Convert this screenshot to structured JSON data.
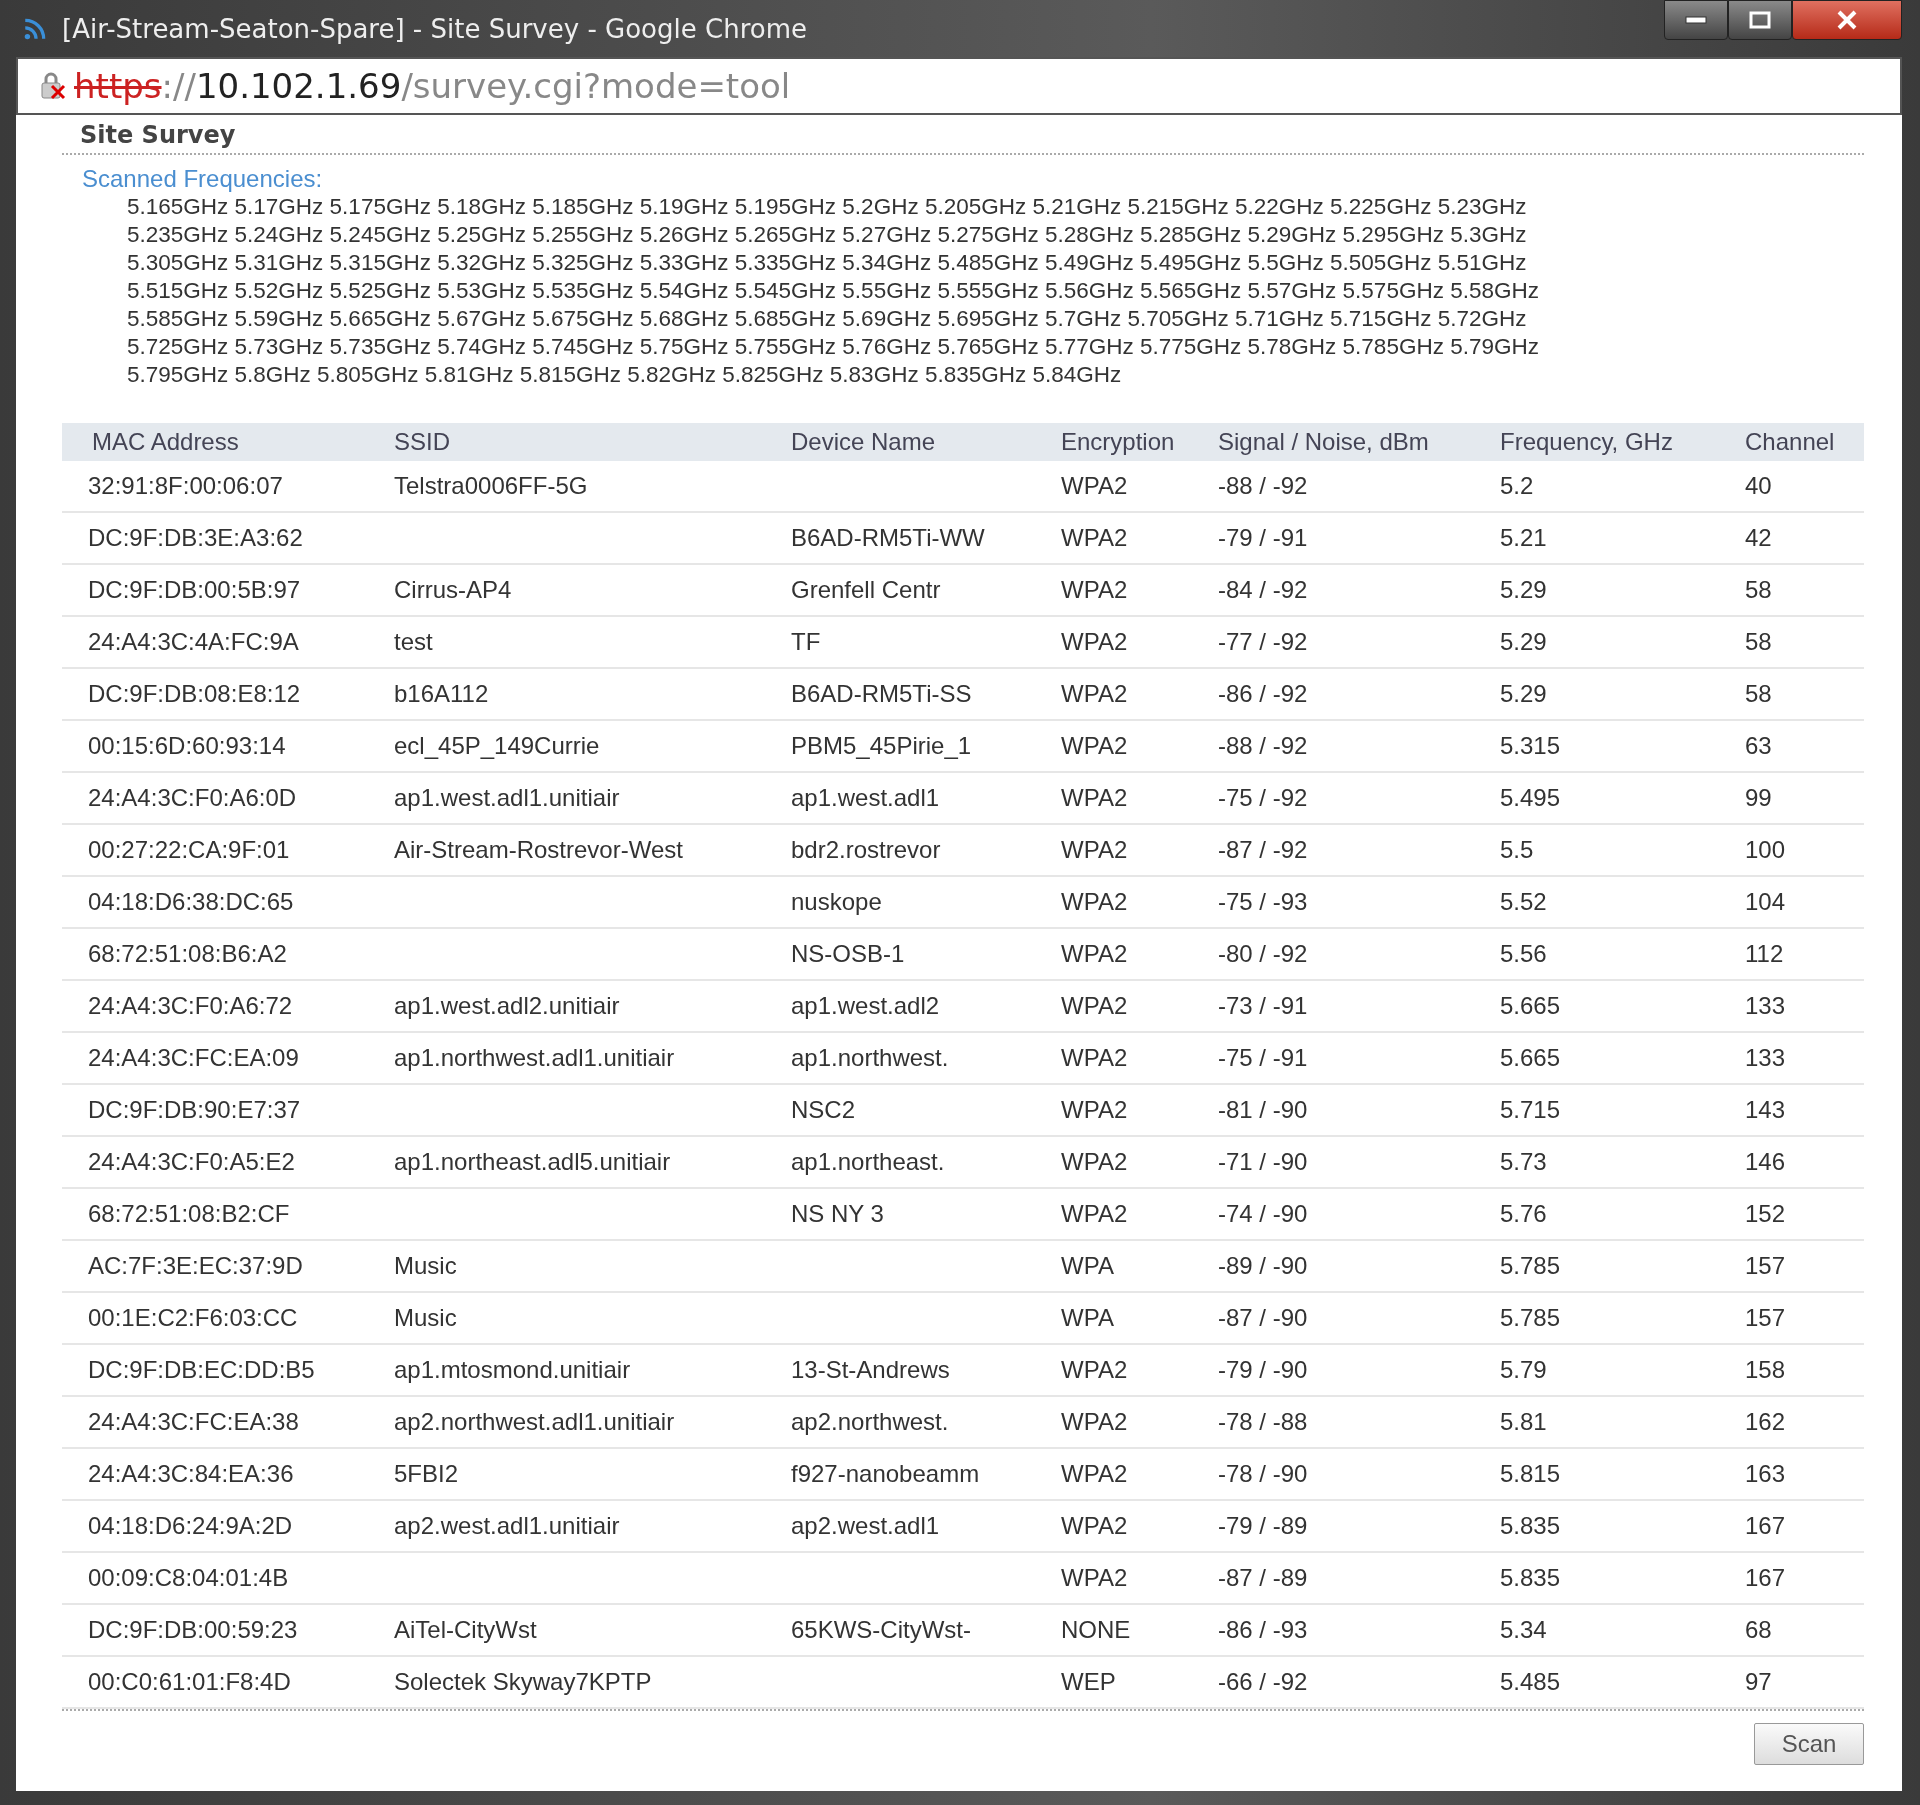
{
  "window": {
    "title": "[Air-Stream-Seaton-Spare] - Site Survey - Google Chrome"
  },
  "address_bar": {
    "scheme": "https",
    "separator": "://",
    "host": "10.102.1.69",
    "path": "/survey.cgi?mode=tool"
  },
  "heading": "Site Survey",
  "scanned_frequencies": {
    "label": "Scanned Frequencies:",
    "lines": [
      "5.165GHz 5.17GHz 5.175GHz 5.18GHz 5.185GHz 5.19GHz 5.195GHz 5.2GHz 5.205GHz 5.21GHz 5.215GHz 5.22GHz 5.225GHz 5.23GHz",
      "5.235GHz 5.24GHz 5.245GHz 5.25GHz 5.255GHz 5.26GHz 5.265GHz 5.27GHz 5.275GHz 5.28GHz 5.285GHz 5.29GHz 5.295GHz 5.3GHz",
      "5.305GHz 5.31GHz 5.315GHz 5.32GHz 5.325GHz 5.33GHz 5.335GHz 5.34GHz 5.485GHz 5.49GHz 5.495GHz 5.5GHz 5.505GHz 5.51GHz",
      "5.515GHz 5.52GHz 5.525GHz 5.53GHz 5.535GHz 5.54GHz 5.545GHz 5.55GHz 5.555GHz 5.56GHz 5.565GHz 5.57GHz 5.575GHz 5.58GHz",
      "5.585GHz 5.59GHz 5.665GHz 5.67GHz 5.675GHz 5.68GHz 5.685GHz 5.69GHz 5.695GHz 5.7GHz 5.705GHz 5.71GHz 5.715GHz 5.72GHz",
      "5.725GHz 5.73GHz 5.735GHz 5.74GHz 5.745GHz 5.75GHz 5.755GHz 5.76GHz 5.765GHz 5.77GHz 5.775GHz 5.78GHz 5.785GHz 5.79GHz",
      "5.795GHz 5.8GHz 5.805GHz 5.81GHz 5.815GHz 5.82GHz 5.825GHz 5.83GHz 5.835GHz 5.84GHz"
    ]
  },
  "table": {
    "columns": [
      "MAC Address",
      "SSID",
      "Device Name",
      "Encryption",
      "Signal / Noise, dBm",
      "Frequency, GHz",
      "Channel"
    ],
    "rows": [
      [
        "32:91:8F:00:06:07",
        "Telstra0006FF-5G",
        "",
        "WPA2",
        "-88 / -92",
        "5.2",
        "40"
      ],
      [
        "DC:9F:DB:3E:A3:62",
        "",
        "B6AD-RM5Ti-WW",
        "WPA2",
        "-79 / -91",
        "5.21",
        "42"
      ],
      [
        "DC:9F:DB:00:5B:97",
        "Cirrus-AP4",
        "Grenfell Centr",
        "WPA2",
        "-84 / -92",
        "5.29",
        "58"
      ],
      [
        "24:A4:3C:4A:FC:9A",
        "test",
        "TF",
        "WPA2",
        "-77 / -92",
        "5.29",
        "58"
      ],
      [
        "DC:9F:DB:08:E8:12",
        "b16A112",
        "B6AD-RM5Ti-SS",
        "WPA2",
        "-86 / -92",
        "5.29",
        "58"
      ],
      [
        "00:15:6D:60:93:14",
        "ecl_45P_149Currie",
        "PBM5_45Pirie_1",
        "WPA2",
        "-88 / -92",
        "5.315",
        "63"
      ],
      [
        "24:A4:3C:F0:A6:0D",
        "ap1.west.adl1.unitiair",
        "ap1.west.adl1",
        "WPA2",
        "-75 / -92",
        "5.495",
        "99"
      ],
      [
        "00:27:22:CA:9F:01",
        "Air-Stream-Rostrevor-West",
        "bdr2.rostrevor",
        "WPA2",
        "-87 / -92",
        "5.5",
        "100"
      ],
      [
        "04:18:D6:38:DC:65",
        "",
        "nuskope",
        "WPA2",
        "-75 / -93",
        "5.52",
        "104"
      ],
      [
        "68:72:51:08:B6:A2",
        "",
        "NS-OSB-1",
        "WPA2",
        "-80 / -92",
        "5.56",
        "112"
      ],
      [
        "24:A4:3C:F0:A6:72",
        "ap1.west.adl2.unitiair",
        "ap1.west.adl2",
        "WPA2",
        "-73 / -91",
        "5.665",
        "133"
      ],
      [
        "24:A4:3C:FC:EA:09",
        "ap1.northwest.adl1.unitiair",
        "ap1.northwest.",
        "WPA2",
        "-75 / -91",
        "5.665",
        "133"
      ],
      [
        "DC:9F:DB:90:E7:37",
        "",
        "NSC2",
        "WPA2",
        "-81 / -90",
        "5.715",
        "143"
      ],
      [
        "24:A4:3C:F0:A5:E2",
        "ap1.northeast.adl5.unitiair",
        "ap1.northeast.",
        "WPA2",
        "-71 / -90",
        "5.73",
        "146"
      ],
      [
        "68:72:51:08:B2:CF",
        "",
        "NS NY 3",
        "WPA2",
        "-74 / -90",
        "5.76",
        "152"
      ],
      [
        "AC:7F:3E:EC:37:9D",
        "Music",
        "",
        "WPA",
        "-89 / -90",
        "5.785",
        "157"
      ],
      [
        "00:1E:C2:F6:03:CC",
        "Music",
        "",
        "WPA",
        "-87 / -90",
        "5.785",
        "157"
      ],
      [
        "DC:9F:DB:EC:DD:B5",
        "ap1.mtosmond.unitiair",
        "13-St-Andrews",
        "WPA2",
        "-79 / -90",
        "5.79",
        "158"
      ],
      [
        "24:A4:3C:FC:EA:38",
        "ap2.northwest.adl1.unitiair",
        "ap2.northwest.",
        "WPA2",
        "-78 / -88",
        "5.81",
        "162"
      ],
      [
        "24:A4:3C:84:EA:36",
        "5FBI2",
        "f927-nanobeamm",
        "WPA2",
        "-78 / -90",
        "5.815",
        "163"
      ],
      [
        "04:18:D6:24:9A:2D",
        "ap2.west.adl1.unitiair",
        "ap2.west.adl1",
        "WPA2",
        "-79 / -89",
        "5.835",
        "167"
      ],
      [
        "00:09:C8:04:01:4B",
        "",
        "",
        "WPA2",
        "-87 / -89",
        "5.835",
        "167"
      ],
      [
        "DC:9F:DB:00:59:23",
        "AiTel-CityWst",
        "65KWS-CityWst-",
        "NONE",
        "-86 / -93",
        "5.34",
        "68"
      ],
      [
        "00:C0:61:01:F8:4D",
        "Solectek Skyway7KPTP",
        "",
        "WEP",
        "-66 / -92",
        "5.485",
        "97"
      ]
    ]
  },
  "buttons": [
    "Scan"
  ]
}
